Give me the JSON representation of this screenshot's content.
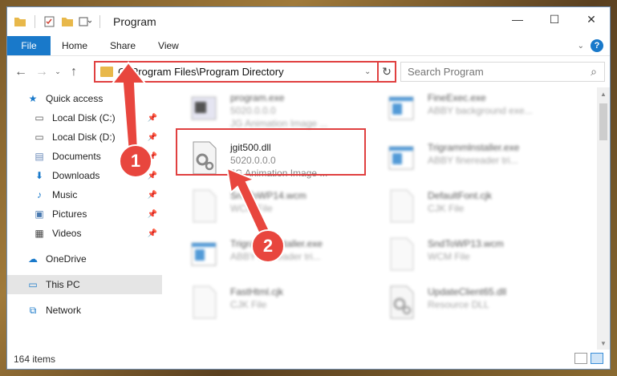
{
  "window": {
    "title": "Program",
    "controls": [
      "minimize",
      "maximize",
      "close"
    ]
  },
  "ribbon": {
    "file": "File",
    "tabs": [
      "Home",
      "Share",
      "View"
    ]
  },
  "address": {
    "path": "C:\\Program Files\\Program Directory"
  },
  "search": {
    "placeholder": "Search Program"
  },
  "nav": {
    "quick_access": "Quick access",
    "items": [
      {
        "label": "Local Disk (C:)",
        "icon": "drive-icon"
      },
      {
        "label": "Local Disk (D:)",
        "icon": "drive-icon"
      },
      {
        "label": "Documents",
        "icon": "documents-icon"
      },
      {
        "label": "Downloads",
        "icon": "downloads-icon"
      },
      {
        "label": "Music",
        "icon": "music-icon"
      },
      {
        "label": "Pictures",
        "icon": "pictures-icon"
      },
      {
        "label": "Videos",
        "icon": "videos-icon"
      }
    ],
    "onedrive": "OneDrive",
    "this_pc": "This PC",
    "network": "Network"
  },
  "files": [
    {
      "name": "program.exe",
      "sub1": "5020.0.0.0",
      "sub2": "JG Animation Image ..."
    },
    {
      "name": "FineExec.exe",
      "sub1": "ABBY background exe...",
      "sub2": ""
    },
    {
      "name": "jgit500.dll",
      "sub1": "5020.0.0.0",
      "sub2": "JG Animation Image ..."
    },
    {
      "name": "Trigrammlnstaller.exe",
      "sub1": "ABBY finereader tri...",
      "sub2": ""
    },
    {
      "name": "SndToWP14.wcm",
      "sub1": "WCM File",
      "sub2": ""
    },
    {
      "name": "DefaultFont.cjk",
      "sub1": "CJK File",
      "sub2": ""
    },
    {
      "name": "TrigrammInstaller.exe",
      "sub1": "ABBY finereader tri...",
      "sub2": ""
    },
    {
      "name": "SndToWP13.wcm",
      "sub1": "WCM File",
      "sub2": ""
    },
    {
      "name": "FastHtml.cjk",
      "sub1": "CJK File",
      "sub2": ""
    },
    {
      "name": "UpdateClient65.dll",
      "sub1": "Resource DLL",
      "sub2": ""
    }
  ],
  "status": {
    "count": "164 items"
  },
  "badges": [
    "1",
    "2"
  ],
  "colors": {
    "accent": "#1979ca",
    "highlight": "#e04040"
  }
}
